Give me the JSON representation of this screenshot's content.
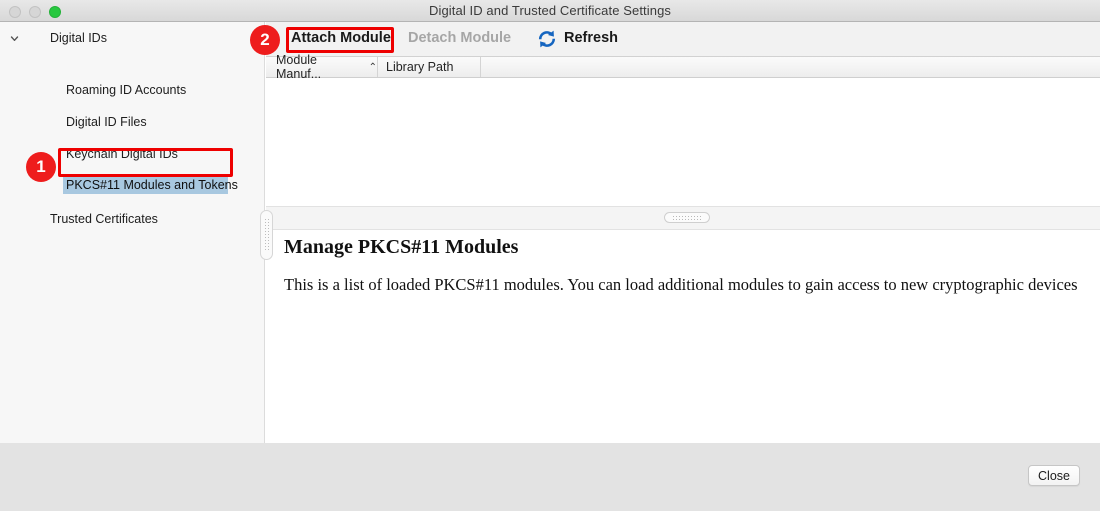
{
  "window": {
    "title": "Digital ID and Trusted Certificate Settings",
    "traffic_lights": {
      "close": "close-button",
      "minimize": "minimize-button",
      "zoom": "zoom-button"
    }
  },
  "sidebar": {
    "root": {
      "label": "Digital IDs",
      "disclosure_icon": "chevron-down-icon",
      "expanded": true
    },
    "items": [
      {
        "label": "Roaming ID Accounts",
        "selected": false
      },
      {
        "label": "Digital ID Files",
        "selected": false
      },
      {
        "label": "Keychain Digital IDs",
        "selected": false
      },
      {
        "label": "PKCS#11 Modules and Tokens",
        "selected": true
      },
      {
        "label": "Trusted Certificates",
        "selected": false
      }
    ],
    "selection_color": "#a8c8e0"
  },
  "toolbar": {
    "attach_label": "Attach Module",
    "detach_label": "Detach Module",
    "detach_enabled": false,
    "refresh_label": "Refresh",
    "refresh_icon": "refresh-icon",
    "refresh_icon_color": "#1565c0"
  },
  "table": {
    "columns": [
      {
        "label": "Module Manuf...",
        "sort_indicator": "⌃",
        "sorted": true
      },
      {
        "label": "Library Path",
        "sort_indicator": "",
        "sorted": false
      }
    ],
    "rows": []
  },
  "detail": {
    "title": "Manage PKCS#11 Modules",
    "description": "This is a list of loaded PKCS#11 modules. You can load additional modules to gain access to new cryptographic devices"
  },
  "footer": {
    "close_label": "Close"
  },
  "annotations": [
    {
      "number": "1",
      "target": "pkcs11-modules-and-tokens-sidebar-item",
      "color": "#ee1d1d"
    },
    {
      "number": "2",
      "target": "attach-module-button",
      "color": "#ee1d1d"
    }
  ]
}
